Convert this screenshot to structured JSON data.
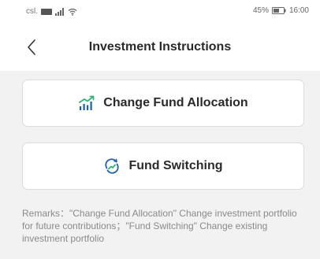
{
  "status_bar": {
    "carrier": "csl.",
    "battery_percent": "45%",
    "time": "16:00"
  },
  "header": {
    "title": "Investment Instructions"
  },
  "options": [
    {
      "label": "Change Fund Allocation",
      "icon": "trend-chart-icon"
    },
    {
      "label": "Fund Switching",
      "icon": "switch-refresh-icon"
    }
  ],
  "remarks": {
    "text": "Remarks：\"Change Fund Allocation\" Change investment portfolio for future contributions；\"Fund Switching\" Change existing investment portfolio"
  },
  "colors": {
    "accent_blue": "#1e5fb4",
    "accent_green": "#2bb673",
    "background": "#f2f2f2"
  }
}
